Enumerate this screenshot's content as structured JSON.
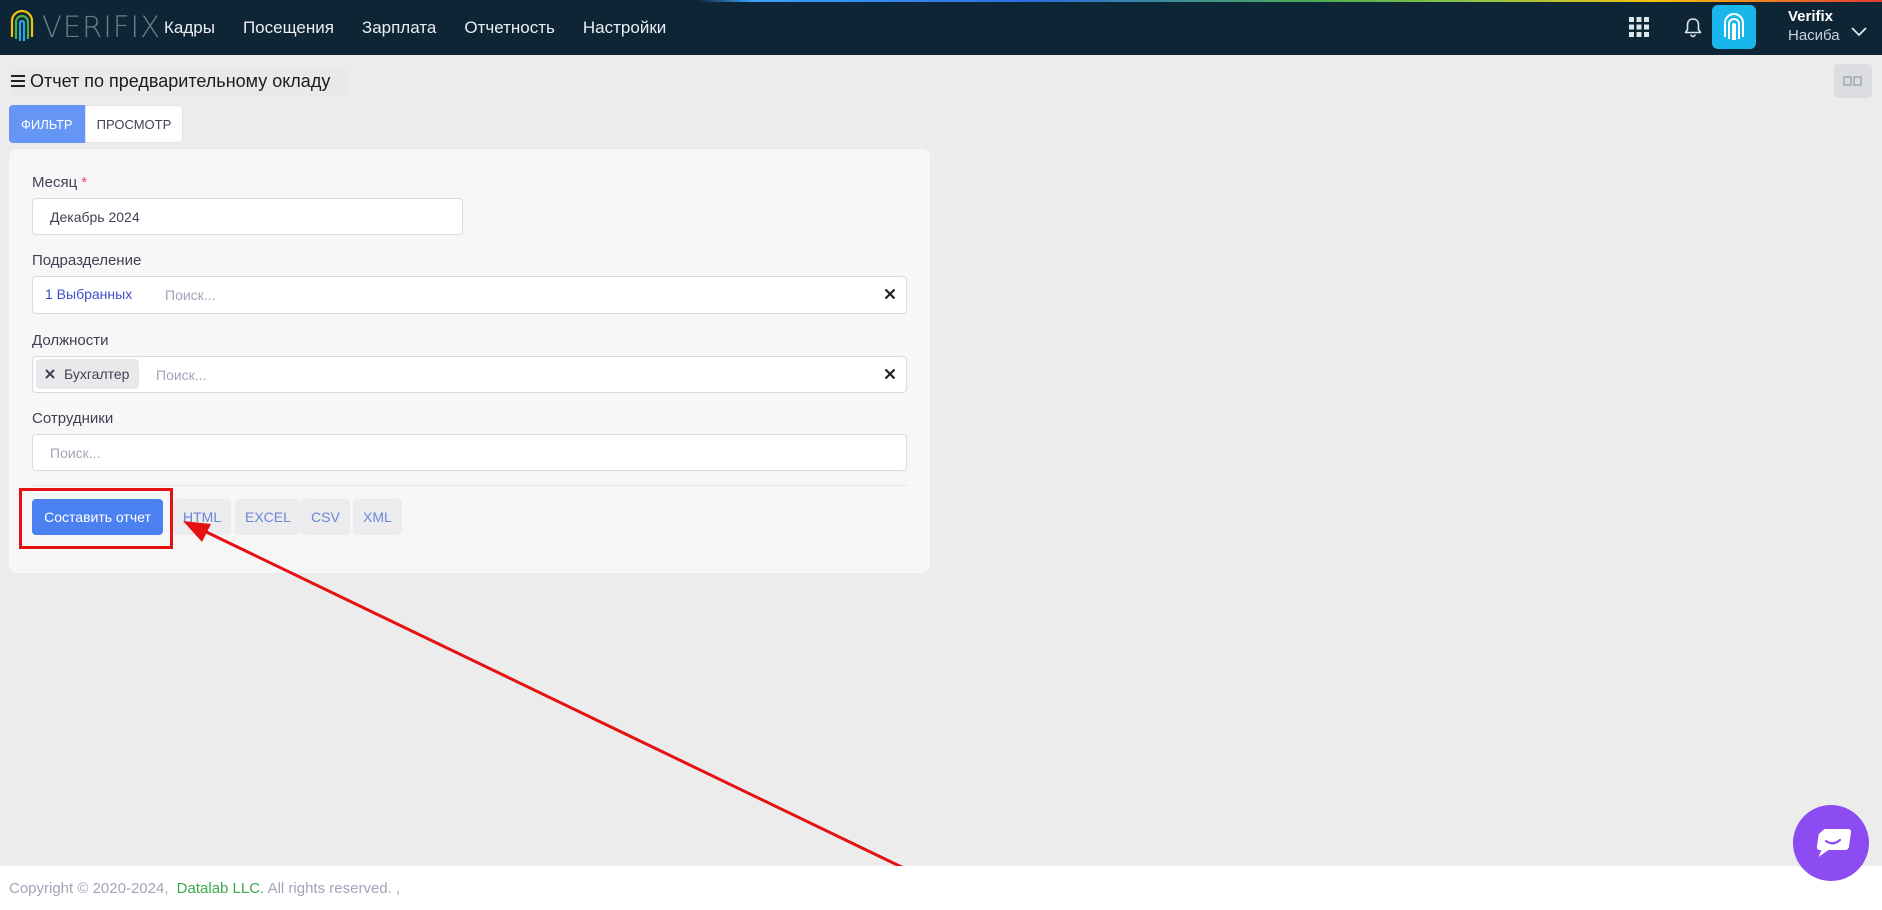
{
  "app": {
    "logo_text": "VERIFIX"
  },
  "nav": {
    "items": [
      "Кадры",
      "Посещения",
      "Зарплата",
      "Отчетность",
      "Настройки"
    ]
  },
  "user": {
    "name": "Verifix",
    "subtitle": "Насиба"
  },
  "page": {
    "title": "Отчет по предварительному окладу"
  },
  "tabs": {
    "filter": "ФИЛЬТР",
    "preview": "ПРОСМОТР"
  },
  "form": {
    "month": {
      "label": "Месяц",
      "required_mark": "*",
      "value": "Декабрь 2024"
    },
    "division": {
      "label": "Подразделение",
      "selected_text": "1 Выбранных",
      "placeholder": "Поиск..."
    },
    "positions": {
      "label": "Должности",
      "chip": "Бухгалтер",
      "placeholder": "Поиск..."
    },
    "employees": {
      "label": "Сотрудники",
      "placeholder": "Поиск..."
    }
  },
  "actions": {
    "build_report": "Составить отчет",
    "html": "HTML",
    "excel": "EXCEL",
    "csv": "CSV",
    "xml": "XML"
  },
  "footer": {
    "copyright": "Copyright © 2020-2024,",
    "company": "Datalab LLC.",
    "rights": "All rights reserved. ,"
  },
  "colors": {
    "topbar": "#0e2536",
    "primary": "#4b80f1",
    "tab_active": "#6596f5",
    "annotation": "#e41212",
    "chat": "#8d4cf2",
    "footer_link": "#3aa84b"
  },
  "icons": [
    "fingerprint-logo-icon",
    "apps-grid-icon",
    "bell-icon",
    "fingerprint-avatar-icon",
    "chevron-down-icon",
    "hamburger-menu-icon",
    "layout-toggle-icon",
    "close-icon",
    "chat-icon"
  ]
}
